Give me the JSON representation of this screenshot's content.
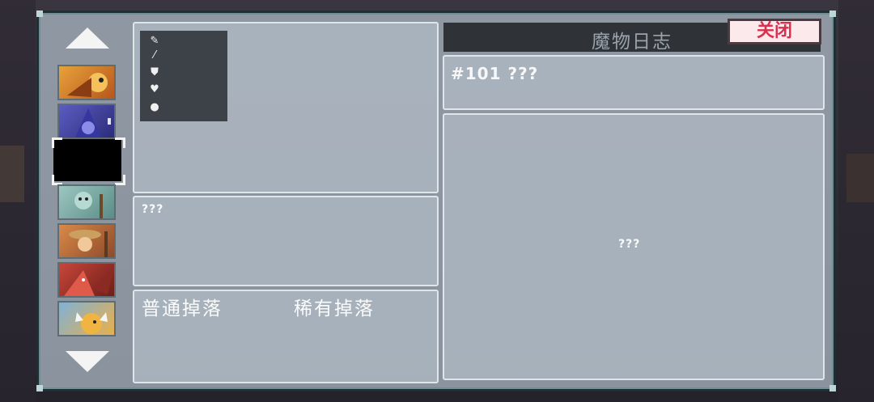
{
  "dialog": {
    "title": "魔物日志",
    "close_label": "关闭"
  },
  "monster": {
    "id_label": "#101 ???",
    "skill_name": "???",
    "info": "???"
  },
  "drops": {
    "common_label": "普通掉落",
    "rare_label": "稀有掉落"
  },
  "stat_icons": [
    "sword-icon",
    "staff-icon",
    "shield-icon",
    "heart-icon",
    "drop-icon"
  ],
  "monster_list": [
    {
      "name": "golden-bird-monster-thumbnail",
      "color": "#d8891f"
    },
    {
      "name": "blue-wizard-monster-thumbnail",
      "color": "#4b4aa8"
    },
    {
      "name": "unknown-monster-thumbnail",
      "color": "#000000"
    },
    {
      "name": "zombie-monster-thumbnail",
      "color": "#7fb2ac"
    },
    {
      "name": "hat-bandit-monster-thumbnail",
      "color": "#c77a3c"
    },
    {
      "name": "red-dragon-monster-thumbnail",
      "color": "#b23a30"
    },
    {
      "name": "horned-beast-monster-thumbnail",
      "color": "#e0a43a"
    }
  ]
}
